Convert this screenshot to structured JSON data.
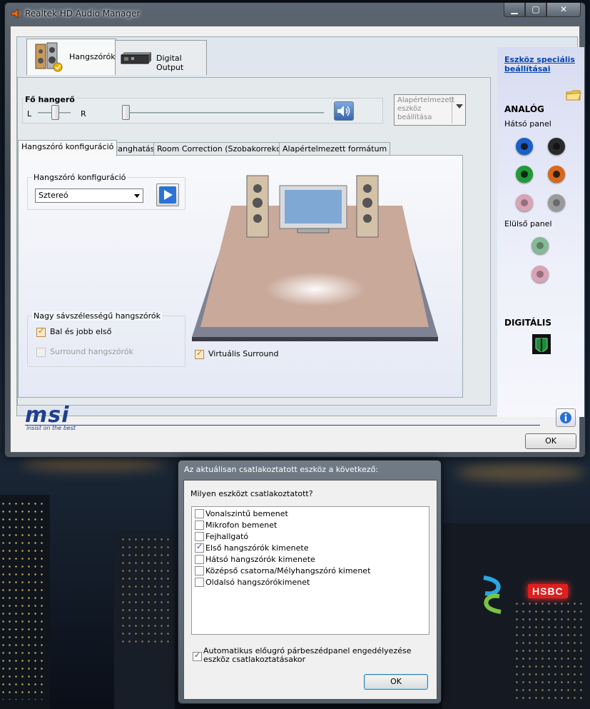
{
  "window": {
    "title": "Realtek HD Audio Manager"
  },
  "device_tabs": [
    {
      "label": "Hangszórók"
    },
    {
      "label": "Digital Output"
    }
  ],
  "volume": {
    "title": "Fő hangerő",
    "left_label": "L",
    "right_label": "R",
    "balance": 0.5,
    "level": 0.0
  },
  "default_device": {
    "label": "Alapértelmezett eszköz beállítása"
  },
  "sub_tabs": [
    {
      "label": "Hangszóró konfiguráció"
    },
    {
      "label": "Hanghatás"
    },
    {
      "label": "Room Correction (Szobakorrekció)"
    },
    {
      "label": "Alapértelmezett formátum"
    }
  ],
  "speaker_config": {
    "group_title": "Hangszóró konfiguráció",
    "selected": "Sztereó"
  },
  "fullrange": {
    "group_title": "Nagy sávszélességű hangszórók",
    "items": [
      {
        "label": "Bal és jobb első",
        "checked": true,
        "enabled": true
      },
      {
        "label": "Surround hangszórók",
        "checked": false,
        "enabled": false
      }
    ]
  },
  "virtual_surround": {
    "label": "Virtuális Surround",
    "checked": true
  },
  "right_panel": {
    "link": "Eszköz speciális beállításai",
    "analog_heading": "ANALÓG",
    "rear_panel": "Hátsó panel",
    "front_panel": "Elülső panel",
    "digital_heading": "DIGITÁLIS",
    "rear_jacks": [
      {
        "color": "#1b5fc9"
      },
      {
        "color": "#2a2a2a"
      },
      {
        "color": "#1f9a37"
      },
      {
        "color": "#d8671b"
      },
      {
        "color": "#d9a3b6"
      },
      {
        "color": "#9a9a9a"
      }
    ],
    "front_jacks": [
      {
        "color": "#86b995"
      },
      {
        "color": "#d9a3b6"
      }
    ]
  },
  "footer": {
    "brand": "msi",
    "tagline": "insist on the best",
    "ok_label": "OK"
  },
  "desktop": {
    "sign": "HSBC"
  },
  "dialog": {
    "title": "Az aktuálisan csatlakoztatott eszköz a következő:",
    "question": "Milyen eszközt csatlakoztatott?",
    "options": [
      {
        "label": "Vonalszintű bemenet",
        "checked": false
      },
      {
        "label": "Mikrofon bemenet",
        "checked": false
      },
      {
        "label": "Fejhallgató",
        "checked": false
      },
      {
        "label": "Első hangszórók kimenete",
        "checked": true
      },
      {
        "label": "Hátsó hangszórók kimenete",
        "checked": false
      },
      {
        "label": "Középső csatorna/Mélyhangszóró kimenet",
        "checked": false
      },
      {
        "label": "Oldalsó hangszórókimenet",
        "checked": false
      }
    ],
    "auto_popup": {
      "label": "Automatikus előugró párbeszédpanel engedélyezése eszköz csatlakoztatásakor",
      "checked": true
    },
    "ok_label": "OK"
  }
}
